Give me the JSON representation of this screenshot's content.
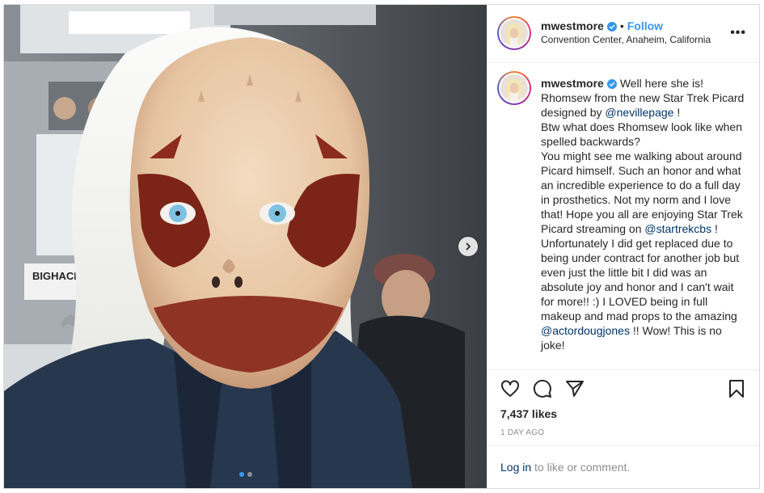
{
  "post": {
    "username": "mwestmore",
    "follow_label": "Follow",
    "separator": "•",
    "location": "Convention Center, Anaheim, California",
    "more_label": "•••",
    "caption_text": "Well here she is!\nRhomsew from the new Star Trek Picard designed by ",
    "caption_mention_1": "@nevillepage",
    "caption_text_2": " !\nBtw what does Rhomsew look like when spelled backwards?\nYou might see me walking about around Picard himself. Such an honor and what an incredible experience to do a full day in prosthetics. Not my norm and I love that! Hope you all are enjoying Star Trek Picard streaming on ",
    "caption_mention_2": "@startrekcbs",
    "caption_text_3": " ! Unfortunately I did get replaced due to being under contract for another job but even just the little bit I did was an absolute joy and honor and I can't wait for more!! :) I LOVED being in full makeup and mad props to the amazing ",
    "caption_mention_3": "@actordougjones",
    "caption_text_4": " !! Wow! This is no joke!",
    "likes": "7,437 likes",
    "time_ago": "1 DAY AGO",
    "login_link": "Log in",
    "login_rest": " to like or comment.",
    "photo_sign_text": "BIGHACK",
    "carousel": {
      "count": 2,
      "active_index": 0
    }
  },
  "icons": {
    "verified": "verified-badge-icon",
    "like": "heart-icon",
    "comment": "comment-icon",
    "share": "paper-plane-icon",
    "save": "bookmark-icon",
    "next": "chevron-right-icon"
  },
  "colors": {
    "accent": "#3897f0",
    "link": "#003569",
    "muted": "#8e8e8e",
    "text": "#262626"
  }
}
